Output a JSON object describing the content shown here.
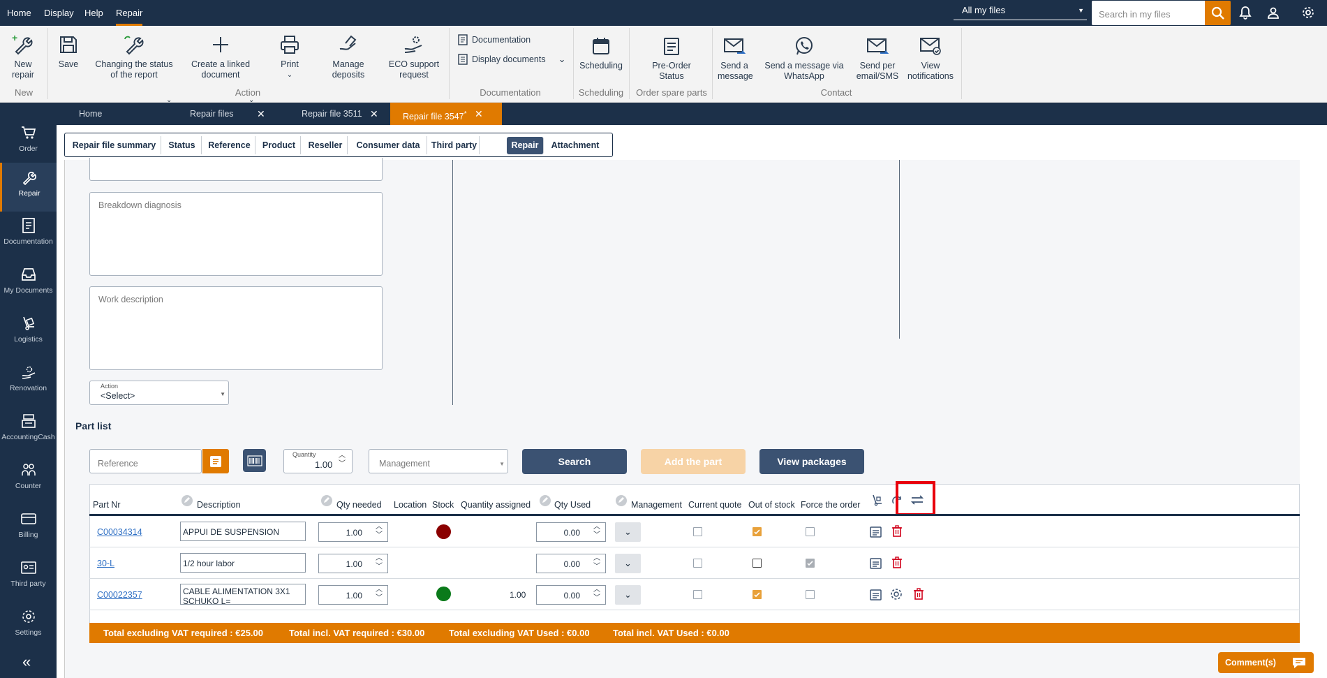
{
  "menu": {
    "home": "Home",
    "display": "Display",
    "help": "Help",
    "repair": "Repair"
  },
  "topbar": {
    "filter": "All my files",
    "search_placeholder": "Search in my files"
  },
  "ribbon": {
    "new_repair": "New repair",
    "save": "Save",
    "changing_status": "Changing the status of the report",
    "create_linked": "Create a linked document",
    "print": "Print",
    "manage_deposits": "Manage deposits",
    "eco_support": "ECO support request",
    "documentation": "Documentation",
    "display_documents": "Display documents",
    "scheduling": "Scheduling",
    "pre_order_status": "Pre-Order Status",
    "send_message": "Send a message",
    "send_whatsapp": "Send a message via WhatsApp",
    "send_email_sms": "Send per email/SMS",
    "view_notifications": "View notifications",
    "groups": {
      "new": "New",
      "action": "Action",
      "documentation": "Documentation",
      "scheduling": "Scheduling",
      "order_spare": "Order spare parts",
      "contact": "Contact"
    }
  },
  "sidebar": {
    "order": "Order",
    "repair": "Repair",
    "documentation": "Documentation",
    "my_documents": "My Documents",
    "logistics": "Logistics",
    "renovation": "Renovation",
    "accounting": "AccountingCash",
    "counter": "Counter",
    "billing": "Billing",
    "third_party": "Third party",
    "settings": "Settings"
  },
  "doc_tabs": {
    "home": "Home",
    "repair_files": "Repair files",
    "repair_3511": "Repair file 3511",
    "repair_3547": "Repair file 3547",
    "modified_mark": "*"
  },
  "sub_tabs": [
    "Repair file summary",
    "Status",
    "Reference",
    "Product",
    "Reseller",
    "Consumer data",
    "Third party",
    "Repair",
    "Attachment"
  ],
  "form": {
    "breakdown_placeholder": "Breakdown diagnosis",
    "work_placeholder": "Work description",
    "action_label": "Action",
    "action_value": "<Select>"
  },
  "part_list": {
    "title": "Part list",
    "reference_placeholder": "Reference",
    "quantity_label": "Quantity",
    "quantity_value": "1.00",
    "management_placeholder": "Management",
    "search_btn": "Search",
    "add_part_btn": "Add the part",
    "view_packages_btn": "View packages",
    "columns": {
      "part_nr": "Part Nr",
      "description": "Description",
      "qty_needed": "Qty needed",
      "location": "Location",
      "stock": "Stock",
      "qty_assigned": "Quantity assigned",
      "qty_used": "Qty Used",
      "management": "Management",
      "current_quote": "Current quote",
      "out_of_stock": "Out of stock",
      "force_order": "Force the order"
    },
    "rows": [
      {
        "part": "C00034314",
        "desc": "APPUI DE SUSPENSION",
        "qty_needed": "1.00",
        "stock_color": "#8b0000",
        "assigned": "",
        "qty_used": "0.00"
      },
      {
        "part": "30-L",
        "desc": "1/2 hour labor",
        "qty_needed": "1.00",
        "stock_color": "",
        "assigned": "",
        "qty_used": "0.00"
      },
      {
        "part": "C00022357",
        "desc": "CABLE ALIMENTATION 3X1 SCHUKO L=",
        "qty_needed": "1.00",
        "stock_color": "#0a7a1a",
        "assigned": "1.00",
        "qty_used": "0.00"
      }
    ],
    "totals": {
      "excl_required": "Total excluding VAT required : €25.00",
      "incl_required": "Total incl. VAT required : €30.00",
      "excl_used": "Total excluding VAT Used : €0.00",
      "incl_used": "Total incl. VAT Used : €0.00"
    }
  },
  "comments_btn": "Comment(s)",
  "colors": {
    "navy": "#1c3049",
    "accent": "#e07a00",
    "highlight": "#e8000d"
  }
}
